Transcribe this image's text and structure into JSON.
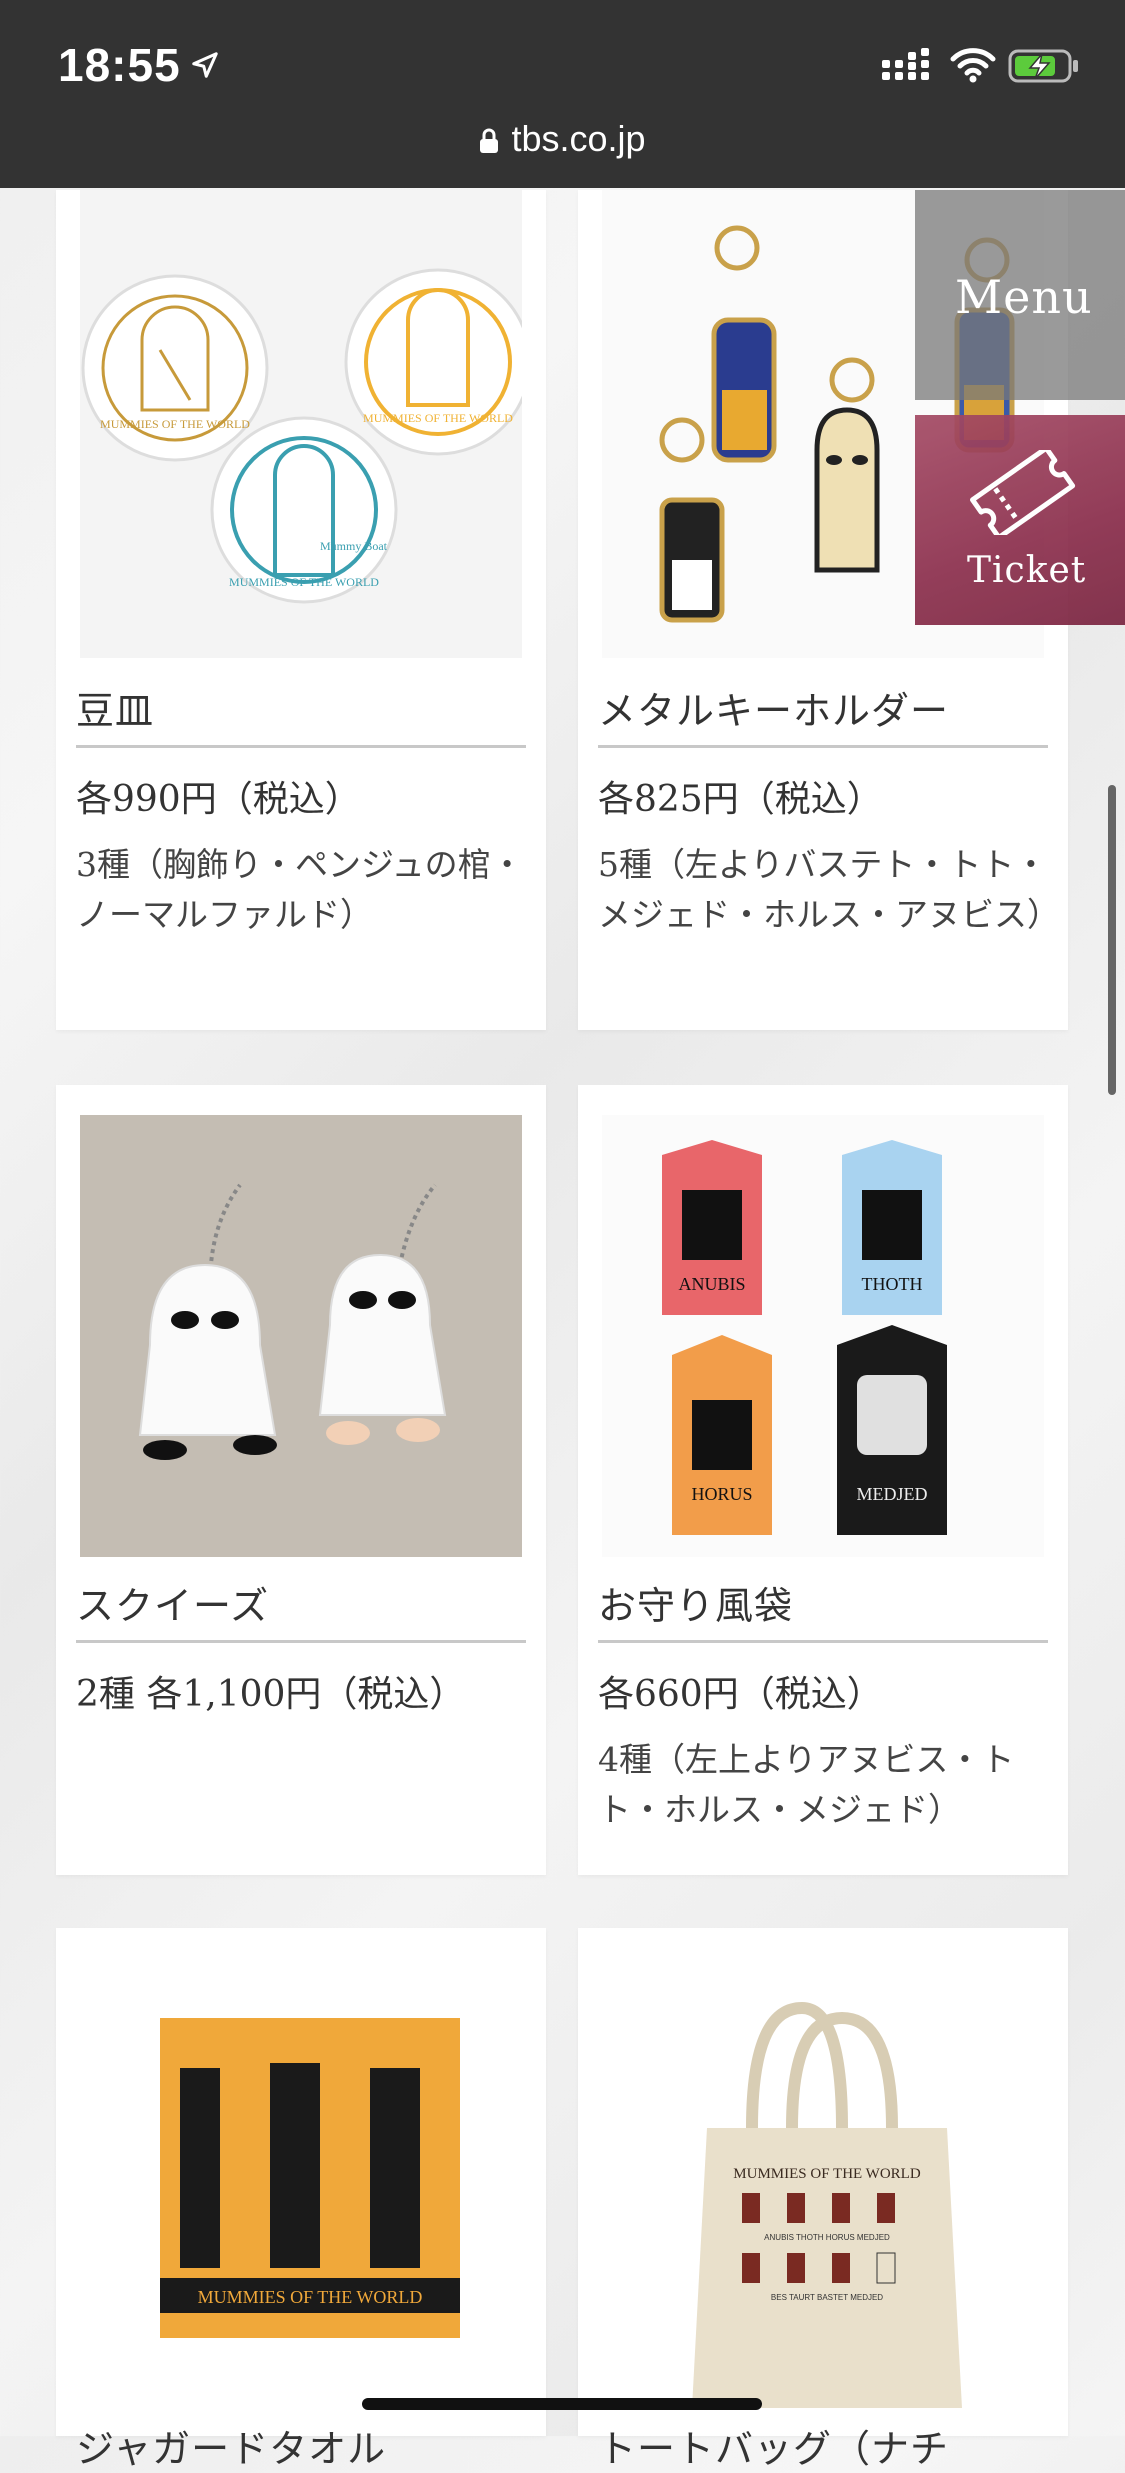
{
  "status_bar": {
    "time": "18:55"
  },
  "browser": {
    "url": "tbs.co.jp"
  },
  "floating": {
    "menu_label": "Menu",
    "ticket_label": "Ticket"
  },
  "products": [
    {
      "title": "豆皿",
      "price": "各990円（税込）",
      "desc": "3種（胸飾り・ペンジュの棺・ノーマルファルド）"
    },
    {
      "title": "メタルキーホルダー",
      "price": "各825円（税込）",
      "desc": "5種（左よりバステト・トト・メジェド・ホルス・アヌビス）"
    },
    {
      "title": "スクイーズ",
      "price": "2種 各1,100円（税込）",
      "desc": ""
    },
    {
      "title": "お守り風袋",
      "price": "各660円（税込）",
      "desc": "4種（左上よりアヌビス・トト・ホルス・メジェド）"
    },
    {
      "title": "ジャガードタオル",
      "price": "",
      "desc": ""
    },
    {
      "title": "トートバッグ（ナチ",
      "price": "",
      "desc": ""
    }
  ],
  "image_text": {
    "plate_text": "MUMMIES OF THE WORLD",
    "plate_label": "Mummy Boat",
    "omamori_1": "ANUBIS",
    "omamori_2": "THOTH",
    "omamori_3": "HORUS",
    "omamori_4": "MEDJED",
    "towel_text": "MUMMIES OF THE WORLD",
    "tote_title": "MUMMIES OF THE WORLD",
    "tote_names": "ANUBIS  THOTH  HORUS  MEDJED",
    "tote_names2": "BES  TAURT  BASTET  MEDJED"
  },
  "colors": {
    "status_bar": "#333333",
    "ticket": "#8b2e4c",
    "menu": "#787878"
  }
}
